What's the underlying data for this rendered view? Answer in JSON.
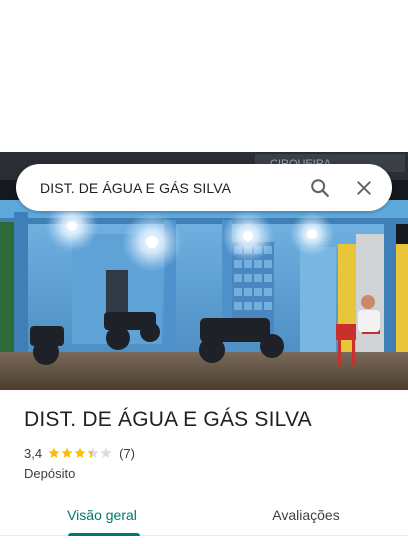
{
  "search": {
    "query": "DIST. DE ÁGUA E GÁS SILVA",
    "search_icon": "search-icon",
    "close_icon": "close-icon"
  },
  "photo": {
    "sign_text": "CIRQUEIRA"
  },
  "place": {
    "title": "DIST. DE ÁGUA E GÁS SILVA",
    "rating": "3,4",
    "rating_value": 3.4,
    "stars_max": 5,
    "review_count": "(7)",
    "category": "Depósito"
  },
  "tabs": [
    {
      "label": "Visão geral",
      "active": true
    },
    {
      "label": "Avaliações",
      "active": false
    }
  ],
  "colors": {
    "accent": "#00796b",
    "star": "#fbbc04",
    "star_empty": "#dadce0"
  }
}
